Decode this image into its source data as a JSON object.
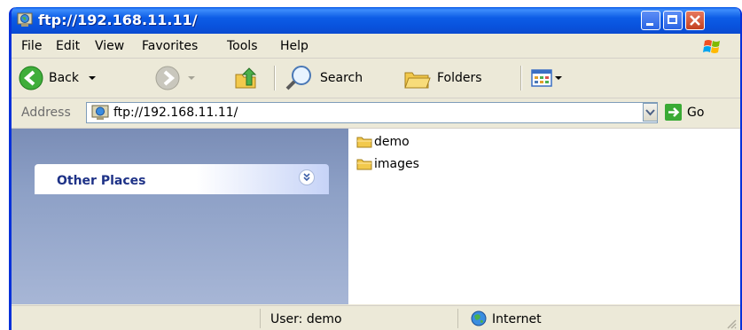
{
  "window": {
    "title": "ftp://192.168.11.11/"
  },
  "menu": [
    "File",
    "Edit",
    "View",
    "Favorites",
    "Tools",
    "Help"
  ],
  "toolbar": {
    "back": "Back",
    "search": "Search",
    "folders": "Folders"
  },
  "address": {
    "label": "Address",
    "value": "ftp://192.168.11.11/",
    "go": "Go"
  },
  "sidebar": {
    "other_places": "Other Places"
  },
  "files": [
    {
      "name": "demo"
    },
    {
      "name": "images"
    }
  ],
  "status": {
    "user": "User: demo",
    "zone": "Internet"
  }
}
